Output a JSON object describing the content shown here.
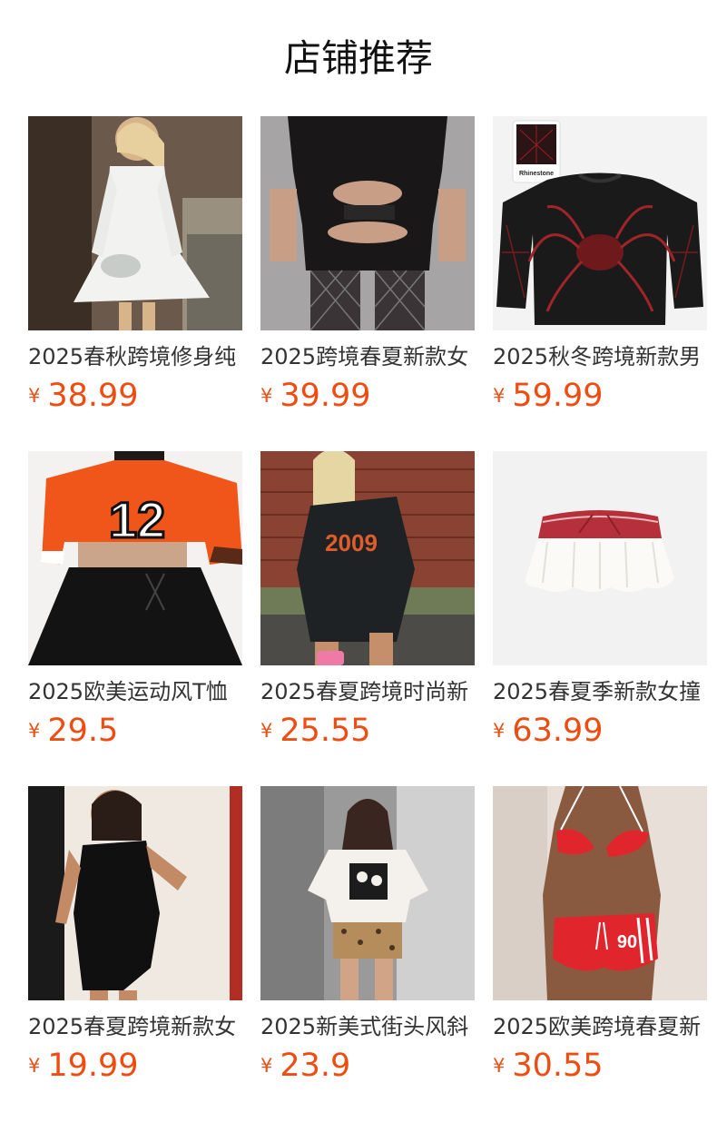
{
  "shop": {
    "title": "店铺推荐"
  },
  "currency_symbol": "¥",
  "products": [
    {
      "name": "2025春秋跨境修身纯",
      "price": "38.99",
      "image_icon": "white-dress-photo"
    },
    {
      "name": "2025跨境春夏新款女",
      "price": "39.99",
      "image_icon": "black-cutout-bodysuit-photo"
    },
    {
      "name": "2025秋冬跨境新款男",
      "price": "59.99",
      "image_icon": "black-spider-sweater-photo",
      "image_tag": "Rhinestone"
    },
    {
      "name": "2025欧美运动风T恤",
      "price": "29.5",
      "image_icon": "orange-jersey-top-photo"
    },
    {
      "name": "2025春夏跨境时尚新",
      "price": "25.55",
      "image_icon": "black-tank-dress-photo"
    },
    {
      "name": "2025春夏季新款女撞",
      "price": "63.99",
      "image_icon": "white-ruffle-skirt-photo"
    },
    {
      "name": "2025春夏跨境新款女",
      "price": "19.99",
      "image_icon": "black-halter-dress-photo"
    },
    {
      "name": "2025新美式街头风斜",
      "price": "23.9",
      "image_icon": "graphic-tee-leopard-shorts-photo"
    },
    {
      "name": "2025欧美跨境春夏新",
      "price": "30.55",
      "image_icon": "red-bikini-set-photo"
    }
  ],
  "colors": {
    "price": "#ee4d12",
    "title": "#111111",
    "name": "#333333"
  }
}
